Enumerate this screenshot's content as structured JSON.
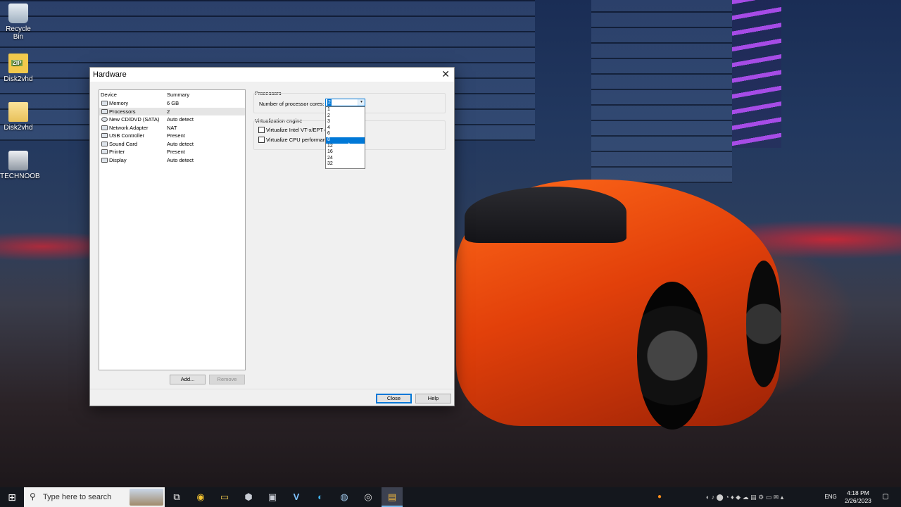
{
  "desktop": {
    "icons": [
      {
        "label": "Recycle Bin",
        "icon": "recycle-bin-icon"
      },
      {
        "label": "Disk2vhd",
        "icon": "zip-archive-icon"
      },
      {
        "label": "Disk2vhd",
        "icon": "folder-icon"
      },
      {
        "label": "TECHNOOB",
        "icon": "drive-icon"
      }
    ]
  },
  "dialog": {
    "title": "Hardware",
    "close_glyph": "✕",
    "device_list": {
      "headers": {
        "device": "Device",
        "summary": "Summary"
      },
      "rows": [
        {
          "device": "Memory",
          "summary": "6 GB",
          "icon": "memory-icon"
        },
        {
          "device": "Processors",
          "summary": "2",
          "icon": "processor-icon",
          "selected": true
        },
        {
          "device": "New CD/DVD (SATA)",
          "summary": "Auto detect",
          "icon": "cd-dvd-icon"
        },
        {
          "device": "Network Adapter",
          "summary": "NAT",
          "icon": "network-adapter-icon"
        },
        {
          "device": "USB Controller",
          "summary": "Present",
          "icon": "usb-controller-icon"
        },
        {
          "device": "Sound Card",
          "summary": "Auto detect",
          "icon": "sound-card-icon"
        },
        {
          "device": "Printer",
          "summary": "Present",
          "icon": "printer-icon"
        },
        {
          "device": "Display",
          "summary": "Auto detect",
          "icon": "display-icon"
        }
      ]
    },
    "buttons": {
      "add": "Add...",
      "remove": "Remove",
      "close": "Close",
      "help": "Help"
    },
    "processors": {
      "group_label": "Processors",
      "cores_label": "Number of processor cores:",
      "cores_value": "2",
      "options": [
        "1",
        "2",
        "3",
        "4",
        "6",
        "8",
        "12",
        "16",
        "24",
        "32"
      ],
      "highlighted_option": "8"
    },
    "virtualization": {
      "group_label": "Virtualization engine",
      "opt1": "Virtualize Intel VT-x/EPT o",
      "opt2": "Virtualize CPU performan"
    }
  },
  "taskbar": {
    "search_placeholder": "Type here to search",
    "start_glyph": "⊞",
    "search_glyph": "⚲",
    "apps": [
      {
        "name": "task-view-icon",
        "glyph": "⧉"
      },
      {
        "name": "chrome-icon",
        "glyph": "◉"
      },
      {
        "name": "file-explorer-icon",
        "glyph": "▭"
      },
      {
        "name": "app-hexagon-icon",
        "glyph": "⬢"
      },
      {
        "name": "app-window-icon",
        "glyph": "▣"
      },
      {
        "name": "vmware-icon",
        "glyph": "V"
      },
      {
        "name": "edge-icon",
        "glyph": "◐"
      },
      {
        "name": "steam-icon",
        "glyph": "◍"
      },
      {
        "name": "obs-icon",
        "glyph": "◎"
      },
      {
        "name": "active-app-icon",
        "glyph": "▤"
      }
    ],
    "tray": {
      "language": "ENG",
      "time": "4:18 PM",
      "date": "2/26/2023",
      "notification_glyph": "▢"
    }
  }
}
